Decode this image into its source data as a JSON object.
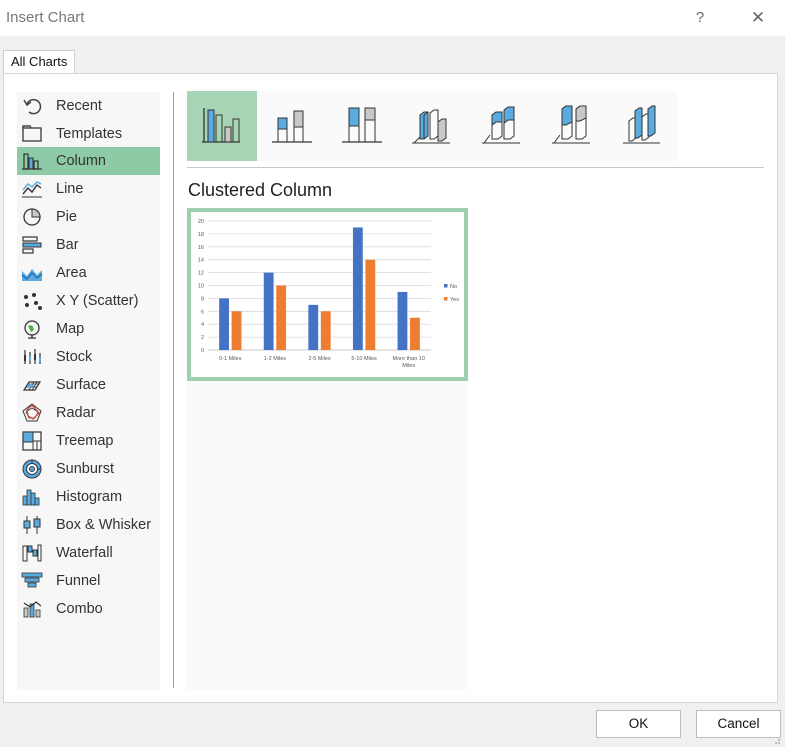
{
  "window": {
    "title": "Insert Chart",
    "help_glyph": "?",
    "close_glyph": "✕"
  },
  "tabs": [
    {
      "label": "All Charts"
    }
  ],
  "sidebar": {
    "items": [
      {
        "label": "Recent",
        "icon": "recent-icon"
      },
      {
        "label": "Templates",
        "icon": "templates-icon"
      },
      {
        "label": "Column",
        "icon": "column-chart-icon",
        "selected": true
      },
      {
        "label": "Line",
        "icon": "line-chart-icon"
      },
      {
        "label": "Pie",
        "icon": "pie-chart-icon"
      },
      {
        "label": "Bar",
        "icon": "bar-chart-icon"
      },
      {
        "label": "Area",
        "icon": "area-chart-icon"
      },
      {
        "label": "X Y (Scatter)",
        "icon": "scatter-chart-icon"
      },
      {
        "label": "Map",
        "icon": "map-chart-icon"
      },
      {
        "label": "Stock",
        "icon": "stock-chart-icon"
      },
      {
        "label": "Surface",
        "icon": "surface-chart-icon"
      },
      {
        "label": "Radar",
        "icon": "radar-chart-icon"
      },
      {
        "label": "Treemap",
        "icon": "treemap-chart-icon"
      },
      {
        "label": "Sunburst",
        "icon": "sunburst-chart-icon"
      },
      {
        "label": "Histogram",
        "icon": "histogram-chart-icon"
      },
      {
        "label": "Box & Whisker",
        "icon": "box-whisker-chart-icon"
      },
      {
        "label": "Waterfall",
        "icon": "waterfall-chart-icon"
      },
      {
        "label": "Funnel",
        "icon": "funnel-chart-icon"
      },
      {
        "label": "Combo",
        "icon": "combo-chart-icon"
      }
    ]
  },
  "subtypes": {
    "selected_index": 0,
    "items": [
      {
        "icon": "clustered-column-icon"
      },
      {
        "icon": "stacked-column-icon"
      },
      {
        "icon": "100-stacked-column-icon"
      },
      {
        "icon": "3d-clustered-column-icon"
      },
      {
        "icon": "3d-stacked-column-icon"
      },
      {
        "icon": "3d-100-stacked-column-icon"
      },
      {
        "icon": "3d-column-icon"
      }
    ]
  },
  "preview": {
    "title": "Clustered Column"
  },
  "buttons": {
    "ok": "OK",
    "cancel": "Cancel"
  },
  "colors": {
    "accent": "#8ecaa5",
    "series_no": "#4472c4",
    "series_yes": "#ed7d31",
    "icon_blue": "#5aabe0"
  },
  "chart_data": {
    "type": "bar",
    "categories": [
      "0-1 Miles",
      "1-2 Miles",
      "2-5 Miles",
      "5-10 Miles",
      "More than 10 Miles"
    ],
    "category_lines": [
      [
        "0-1 Miles"
      ],
      [
        "1-2 Miles"
      ],
      [
        "2-5 Miles"
      ],
      [
        "5-10 Miles"
      ],
      [
        "More than 10",
        "Miles"
      ]
    ],
    "series": [
      {
        "name": "No",
        "values": [
          8,
          12,
          7,
          19,
          9
        ],
        "color": "#4472c4"
      },
      {
        "name": "Yes",
        "values": [
          6,
          10,
          6,
          14,
          5
        ],
        "color": "#ed7d31"
      }
    ],
    "ylim": [
      0,
      20
    ],
    "yticks": [
      0,
      2,
      4,
      6,
      8,
      10,
      12,
      14,
      16,
      18,
      20
    ],
    "grid": true,
    "legend": "right"
  }
}
